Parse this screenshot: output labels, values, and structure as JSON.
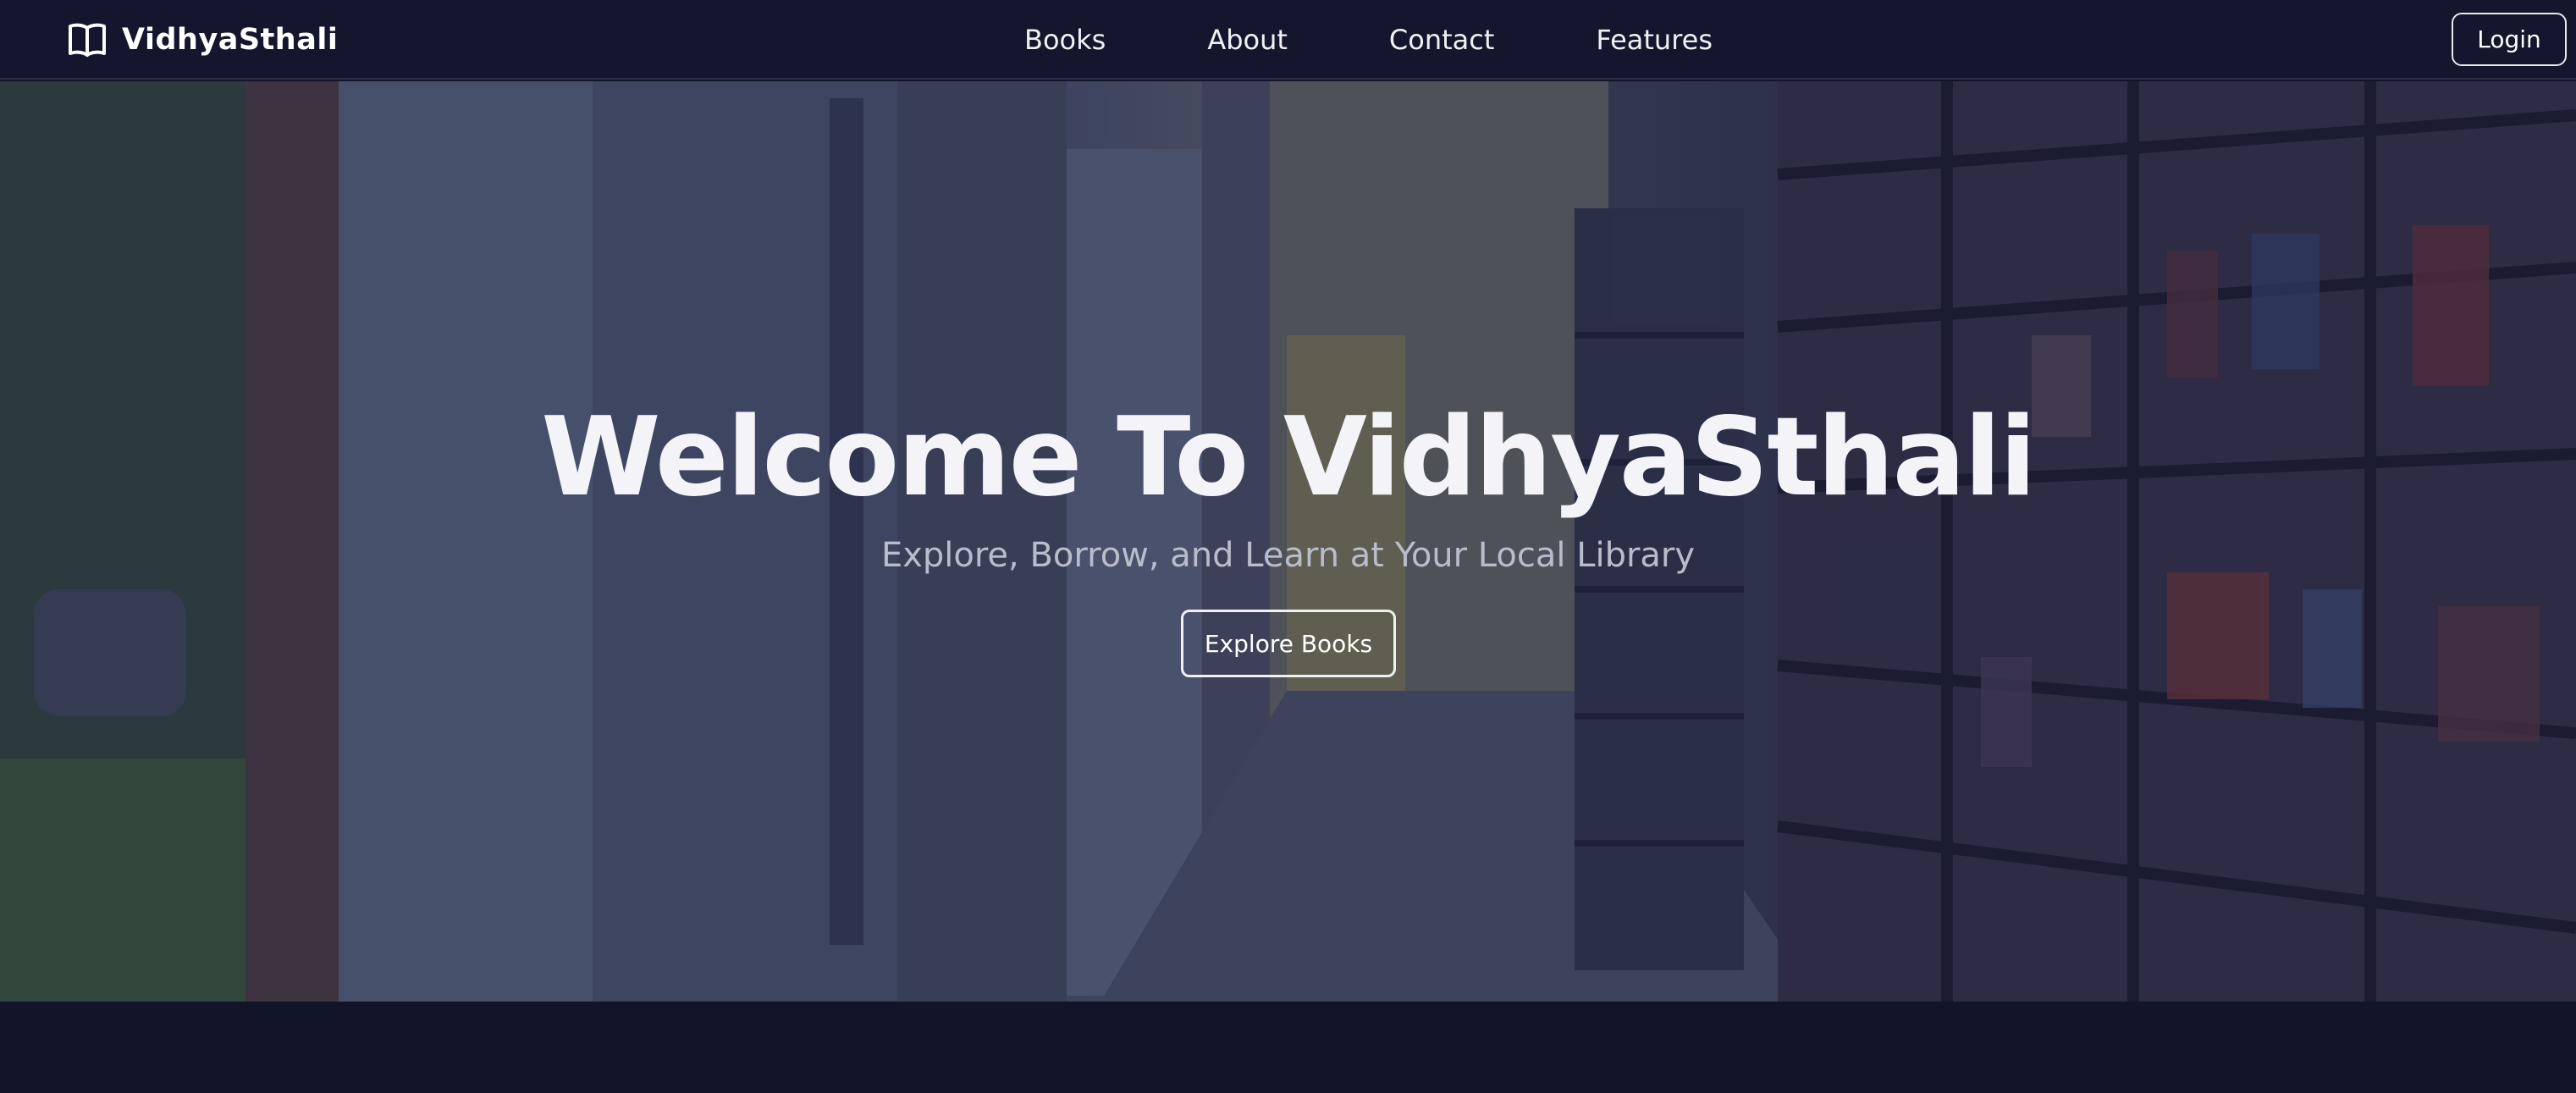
{
  "brand": {
    "name": "VidhyaSthali",
    "icon": "open-book-icon"
  },
  "nav": {
    "links": [
      {
        "label": "Books"
      },
      {
        "label": "About"
      },
      {
        "label": "Contact"
      },
      {
        "label": "Features"
      }
    ],
    "login_label": "Login"
  },
  "hero": {
    "title": "Welcome To VidhyaSthali",
    "subtitle": "Explore, Borrow, and Learn at Your Local Library",
    "cta_label": "Explore Books"
  },
  "colors": {
    "navbar_bg": "#13162c",
    "page_bg": "#12142a",
    "text": "#ffffff"
  }
}
